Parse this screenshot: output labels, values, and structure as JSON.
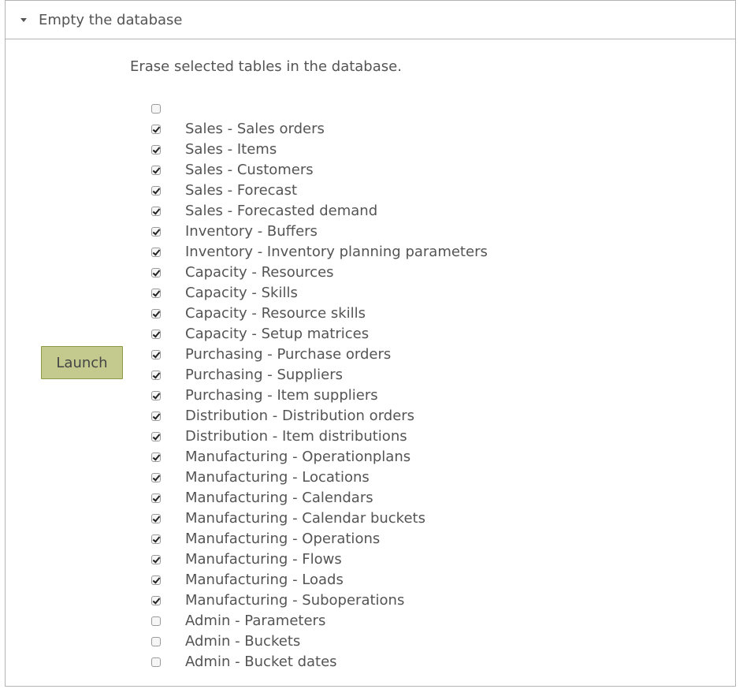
{
  "panel": {
    "title": "Empty the database",
    "description": "Erase selected tables in the database.",
    "launch_label": "Launch",
    "select_all_checked": false,
    "tables": [
      {
        "label": "Sales - Sales orders",
        "checked": true
      },
      {
        "label": "Sales - Items",
        "checked": true
      },
      {
        "label": "Sales - Customers",
        "checked": true
      },
      {
        "label": "Sales - Forecast",
        "checked": true
      },
      {
        "label": "Sales - Forecasted demand",
        "checked": true
      },
      {
        "label": "Inventory - Buffers",
        "checked": true
      },
      {
        "label": "Inventory - Inventory planning parameters",
        "checked": true
      },
      {
        "label": "Capacity - Resources",
        "checked": true
      },
      {
        "label": "Capacity - Skills",
        "checked": true
      },
      {
        "label": "Capacity - Resource skills",
        "checked": true
      },
      {
        "label": "Capacity - Setup matrices",
        "checked": true
      },
      {
        "label": "Purchasing - Purchase orders",
        "checked": true
      },
      {
        "label": "Purchasing - Suppliers",
        "checked": true
      },
      {
        "label": "Purchasing - Item suppliers",
        "checked": true
      },
      {
        "label": "Distribution - Distribution orders",
        "checked": true
      },
      {
        "label": "Distribution - Item distributions",
        "checked": true
      },
      {
        "label": "Manufacturing - Operationplans",
        "checked": true
      },
      {
        "label": "Manufacturing - Locations",
        "checked": true
      },
      {
        "label": "Manufacturing - Calendars",
        "checked": true
      },
      {
        "label": "Manufacturing - Calendar buckets",
        "checked": true
      },
      {
        "label": "Manufacturing - Operations",
        "checked": true
      },
      {
        "label": "Manufacturing - Flows",
        "checked": true
      },
      {
        "label": "Manufacturing - Loads",
        "checked": true
      },
      {
        "label": "Manufacturing - Suboperations",
        "checked": true
      },
      {
        "label": "Admin - Parameters",
        "checked": false
      },
      {
        "label": "Admin - Buckets",
        "checked": false
      },
      {
        "label": "Admin - Bucket dates",
        "checked": false
      }
    ]
  }
}
